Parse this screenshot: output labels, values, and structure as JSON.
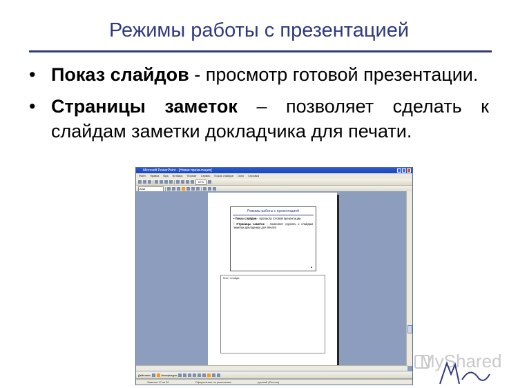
{
  "slide": {
    "title": "Режимы работы с презентацией",
    "bullets": [
      {
        "bold": "Показ слайдов",
        "rest": " - просмотр готовой презентации."
      },
      {
        "bold": "Страницы заметок",
        "rest": " – позволяет сделать к слайдам заметки докладчика для печати."
      }
    ]
  },
  "embedded_app": {
    "window_title": "Microsoft PowerPoint - [Новая презентация]",
    "menu": [
      "Файл",
      "Правка",
      "Вид",
      "Вставка",
      "Формат",
      "Сервис",
      "Показ слайдов",
      "Окно",
      "Справка"
    ],
    "zoom": "67%",
    "font_name": "Arial",
    "thumbnail": {
      "title": "Режимы работы с презентацией",
      "bullet1_bold": "Показ слайдов",
      "bullet1_rest": " - просмотр готовой презентации.",
      "bullet2_bold": "Страницы заметок",
      "bullet2_rest": " – позволяет сделать к слайдам заметки докладчика для печати"
    },
    "notes_label": "Текст слайда",
    "drawbar_label": "Действия",
    "autoshapes_label": "Автофигуры",
    "status": [
      "Заметки 17 из 20",
      "Оформление по умолчанию",
      "русский (Россия)"
    ]
  },
  "watermark": "MyShared"
}
